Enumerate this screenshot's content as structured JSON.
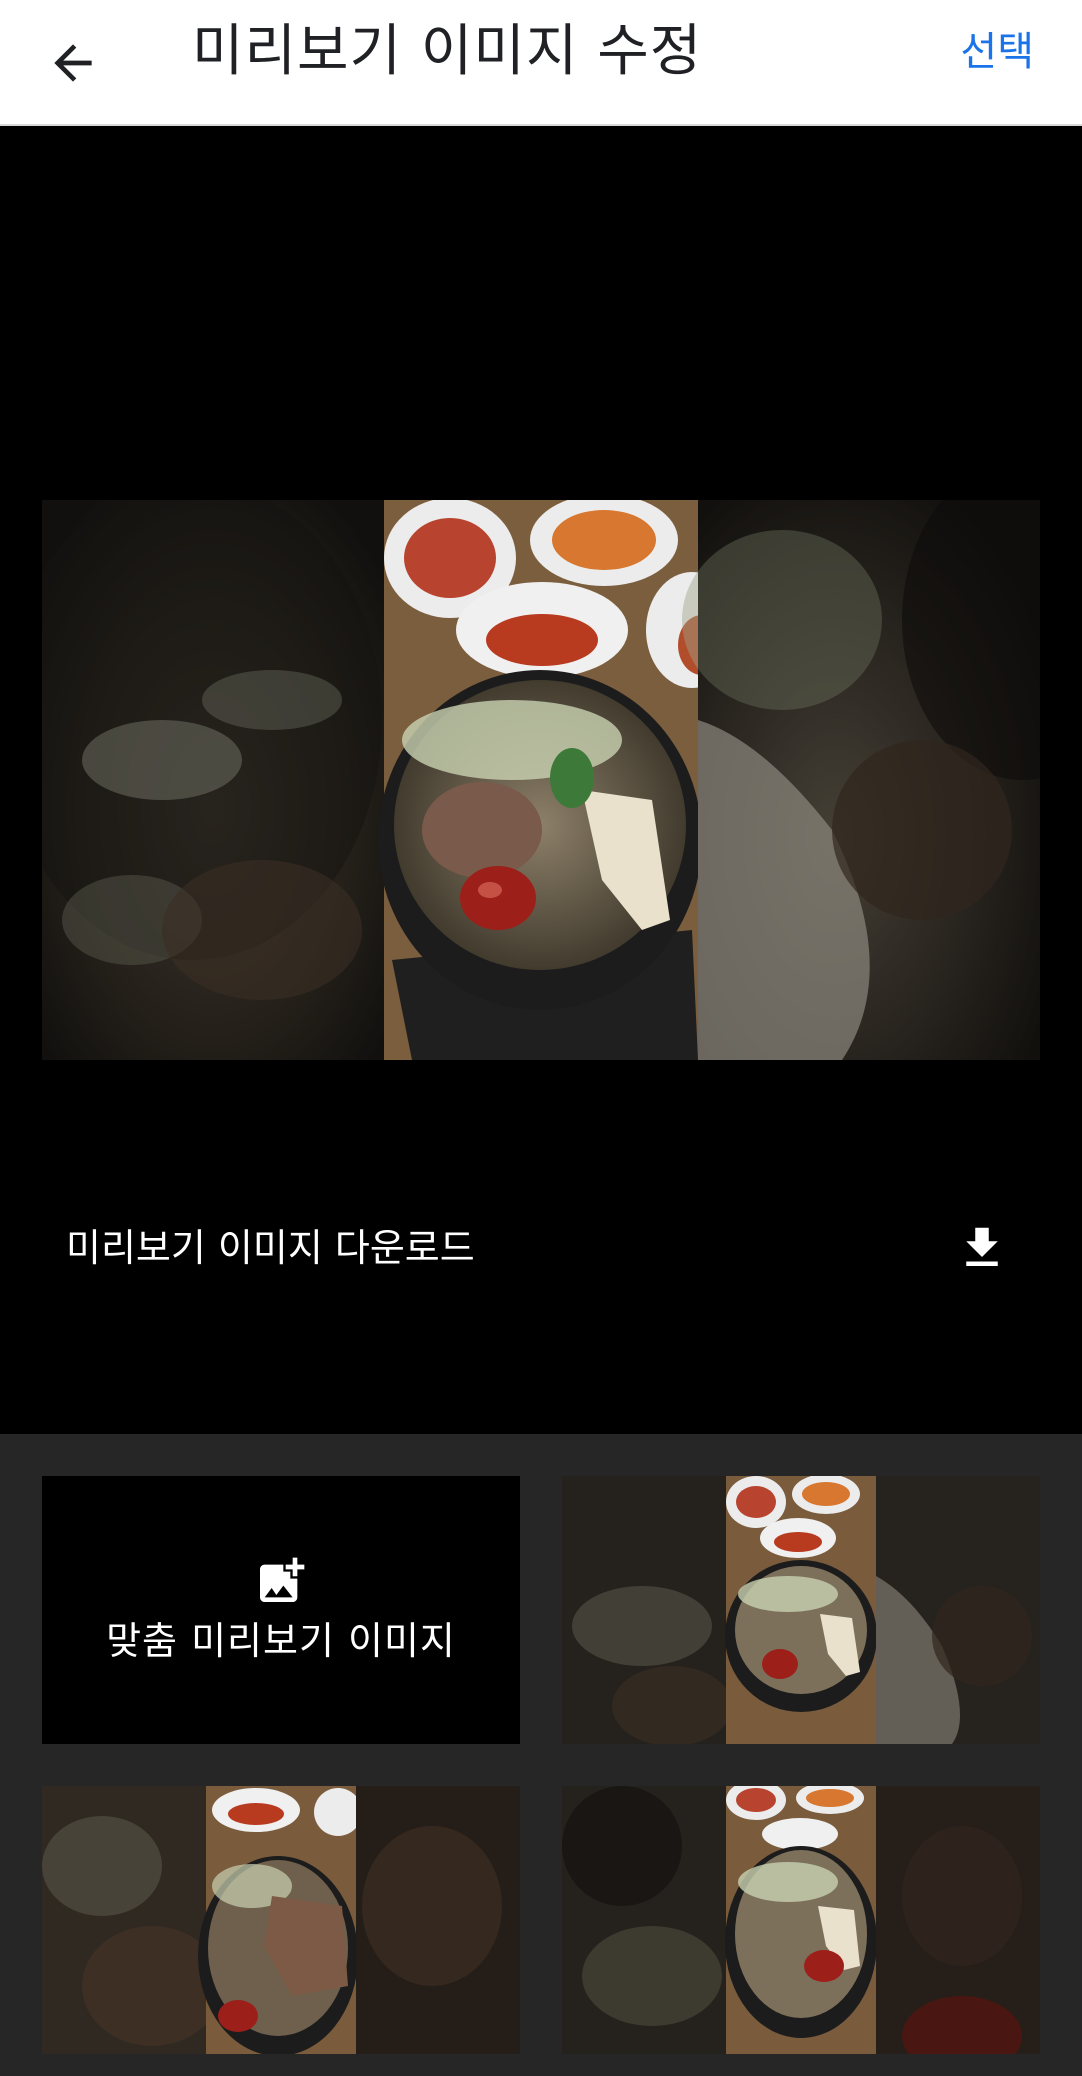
{
  "appbar": {
    "title": "미리보기 이미지 수정",
    "select_label": "선택",
    "back_icon": "arrow-back-icon"
  },
  "preview": {
    "download_label": "미리보기 이미지 다운로드",
    "download_icon": "download-icon"
  },
  "grid": {
    "custom_label": "맞춤 미리보기 이미지",
    "custom_icon": "add-photo-icon"
  },
  "colors": {
    "accent": "#1a73e8",
    "appbar_bg": "#ffffff",
    "preview_bg": "#000000",
    "grid_bg": "#262626"
  }
}
